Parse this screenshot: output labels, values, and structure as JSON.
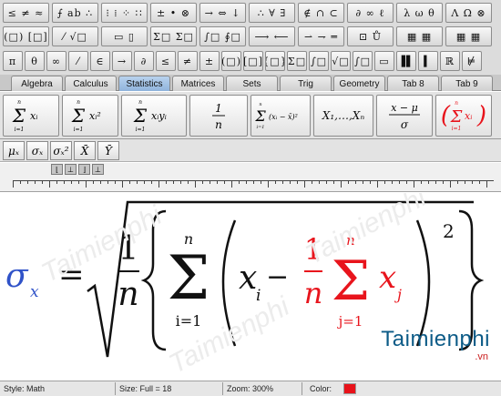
{
  "palette": {
    "rows": [
      [
        "≤ ≠ ≈",
        "⨍ ab ∴",
        "⁝ ⁞ ⁘ ∷",
        "± • ⊗",
        "→ ⇔ ↓",
        "∴ ∀ ∃",
        "∉ ∩ ⊂",
        "∂ ∞ ℓ",
        "λ ω θ",
        "Λ Ω ⊗"
      ],
      [
        "(□) [□]",
        "⁄ √□",
        "▭ ▯",
        "Σ□ Σ□",
        "∫□ ∮□",
        "⟶ ⟵",
        "⇀ ⇁ ═",
        "⊡ Ů",
        "▦ ▦",
        "▦ ▦"
      ],
      [
        "π",
        "θ",
        "∞",
        "⁄",
        "∈",
        "→",
        "∂",
        "≤",
        "≠",
        "±",
        "(□)",
        "[□]",
        "{□}",
        "Σ□",
        "∫□",
        "√□",
        "∫□",
        "▭",
        "▐▌",
        "▍",
        "ℝ",
        "⊭"
      ]
    ]
  },
  "tabs": [
    "Algebra",
    "Calculus",
    "Statistics",
    "Matrices",
    "Sets",
    "Trig",
    "Geometry",
    "Tab 8",
    "Tab 9"
  ],
  "active_tab": "Statistics",
  "templates": {
    "sum_x": {
      "sup": "n",
      "sigma": "Σ",
      "body": "xᵢ",
      "sub": "i=1"
    },
    "sum_x2": {
      "sup": "n",
      "sigma": "Σ",
      "body": "xᵢ²",
      "sub": "i=1"
    },
    "sum_xy": {
      "sup": "n",
      "sigma": "Σ",
      "body": "xᵢyᵢ",
      "sub": "i=1"
    },
    "one_over_n": {
      "num": "1",
      "den": "n"
    },
    "sum_sq": {
      "sup": "n",
      "sigma": "Σ",
      "body": "(xᵢ − x̄)²",
      "sub": "i=1"
    },
    "sequence": "X₁,…,Xₙ",
    "zscore": {
      "num": "x − μ",
      "den": "σ"
    },
    "sum_paren": {
      "sup": "n",
      "sigma": "Σ",
      "body": "xᵢ",
      "sub": "i=1"
    }
  },
  "small_templates": [
    "μₓ",
    "σₓ",
    "σₓ²",
    "X̄",
    "Ȳ"
  ],
  "formula": {
    "lhs": "σ",
    "lhs_sub": "x",
    "equals": "=",
    "one": "1",
    "n": "n",
    "sigma": "Σ",
    "sup_n": "n",
    "sub_i": "i=1",
    "x": "x",
    "i": "i",
    "minus": "−",
    "red_one": "1",
    "red_n": "n",
    "sup_n2": "n",
    "sub_j": "j=1",
    "red_x": "x",
    "j": "j",
    "exponent": "2",
    "colors": {
      "lhs": "#2f52c8",
      "red": "#e8141c",
      "black": "#111111"
    }
  },
  "watermark": {
    "logo": "Taimienphi",
    "logo_sub": ".vn",
    "wm_text": "Taimienphi"
  },
  "status": {
    "style": "Style: Math",
    "size": "Size: Full = 18",
    "zoom": "Zoom: 300%",
    "color_label": "Color:",
    "color_value": "#e8121a"
  }
}
